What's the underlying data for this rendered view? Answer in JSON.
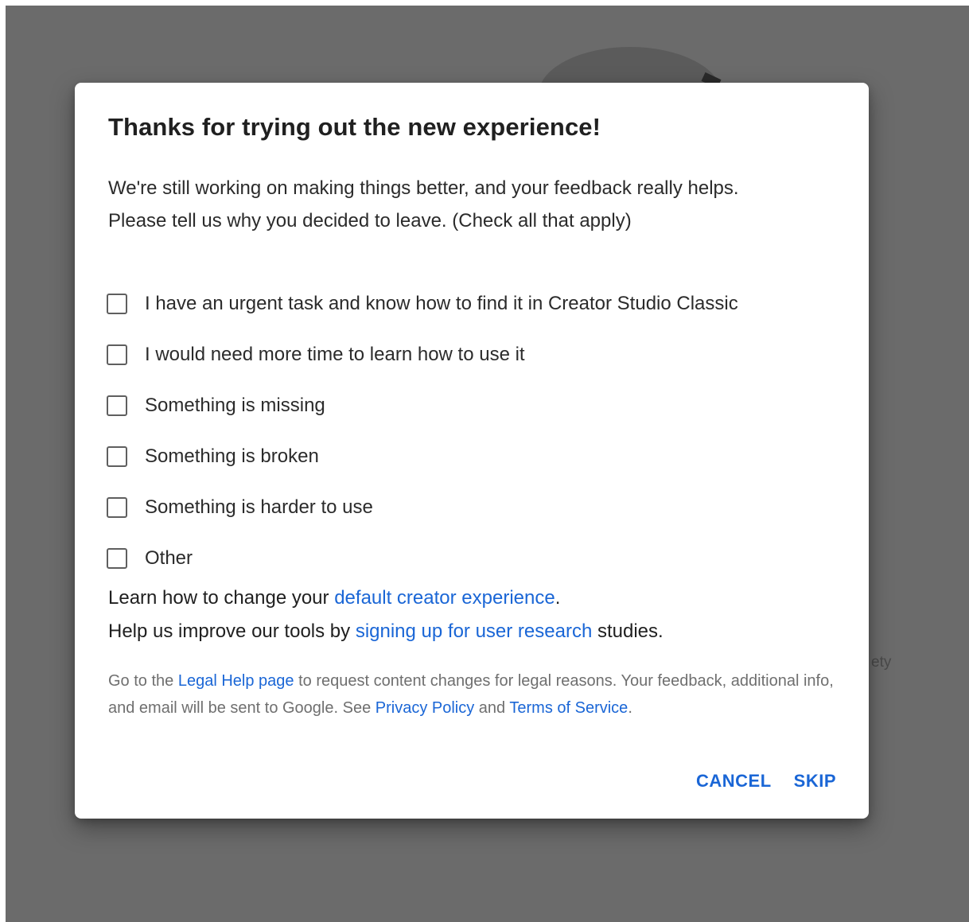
{
  "background": {
    "partial_text": "ety"
  },
  "dialog": {
    "title": "Thanks for trying out the new experience!",
    "description_line1": "We're still working on making things better, and your feedback really helps.",
    "description_line2": "Please tell us why you decided to leave. (Check all that apply)",
    "options": [
      {
        "label": "I have an urgent task and know how to find it in Creator Studio Classic",
        "checked": false
      },
      {
        "label": "I would need more time to learn how to use it",
        "checked": false
      },
      {
        "label": "Something is missing",
        "checked": false
      },
      {
        "label": "Something is broken",
        "checked": false
      },
      {
        "label": "Something is harder to use",
        "checked": false
      },
      {
        "label": "Other",
        "checked": false
      }
    ],
    "learn": {
      "prefix": "Learn how to change your ",
      "link": "default creator experience",
      "suffix": "."
    },
    "research": {
      "prefix": "Help us improve our tools by ",
      "link": "signing up for user research",
      "suffix": " studies."
    },
    "legal": {
      "prefix": "Go to the ",
      "legal_link": "Legal Help page",
      "middle": " to request content changes for legal reasons. Your feedback, additional info, and email will be sent to Google. See ",
      "privacy_link": "Privacy Policy",
      "and": " and ",
      "terms_link": "Terms of Service",
      "suffix": "."
    },
    "buttons": {
      "cancel": "CANCEL",
      "skip": "SKIP"
    }
  },
  "colors": {
    "link": "#1a66d6",
    "backdrop": "#6b6b6b"
  }
}
